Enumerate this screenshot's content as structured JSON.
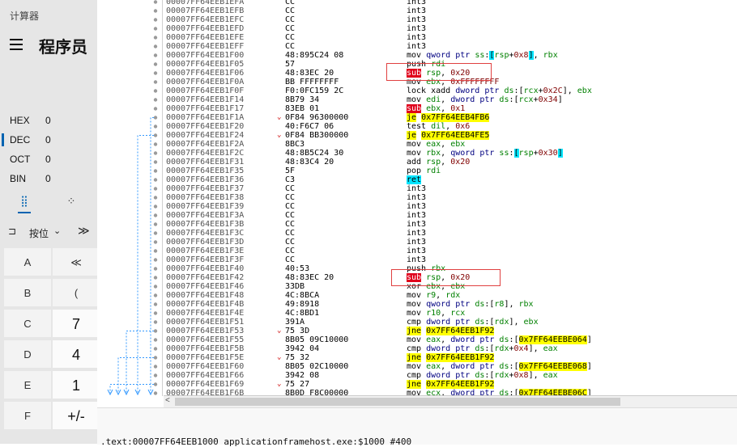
{
  "calculator": {
    "title": "计算器",
    "mode": "程序员",
    "bases": [
      {
        "label": "HEX",
        "value": "0",
        "active": false
      },
      {
        "label": "DEC",
        "value": "0",
        "active": true
      },
      {
        "label": "OCT",
        "value": "0",
        "active": false
      },
      {
        "label": "BIN",
        "value": "0",
        "active": false
      }
    ],
    "keyboard_tabs": [
      "⣿",
      "⁘"
    ],
    "bitwise": {
      "icon": "⊐",
      "label": "按位",
      "chevron": "⌄",
      "shift": "≫"
    },
    "keys": [
      {
        "label": "A",
        "kind": "op"
      },
      {
        "label": "≪",
        "kind": "op"
      },
      {
        "label": "B",
        "kind": "op"
      },
      {
        "label": "(",
        "kind": "op"
      },
      {
        "label": "C",
        "kind": "op"
      },
      {
        "label": "7",
        "kind": "num"
      },
      {
        "label": "D",
        "kind": "op"
      },
      {
        "label": "4",
        "kind": "num"
      },
      {
        "label": "E",
        "kind": "op"
      },
      {
        "label": "1",
        "kind": "num"
      },
      {
        "label": "F",
        "kind": "op"
      },
      {
        "label": "+/-",
        "kind": "num"
      }
    ]
  },
  "debugger": {
    "colors": {
      "red_hl": "#e0001b",
      "yellow_hl": "#ffff00",
      "cyan_hl": "#00e5ff",
      "jump_line": "#3399ff"
    },
    "rows": [
      {
        "addr": "00007FF64EEB1EFA",
        "bytes": "CC",
        "ins": [
          [
            "mn",
            "int3"
          ]
        ]
      },
      {
        "addr": "00007FF64EEB1EFB",
        "bytes": "CC",
        "ins": [
          [
            "mn",
            "int3"
          ]
        ]
      },
      {
        "addr": "00007FF64EEB1EFC",
        "bytes": "CC",
        "ins": [
          [
            "mn",
            "int3"
          ]
        ]
      },
      {
        "addr": "00007FF64EEB1EFD",
        "bytes": "CC",
        "ins": [
          [
            "mn",
            "int3"
          ]
        ]
      },
      {
        "addr": "00007FF64EEB1EFE",
        "bytes": "CC",
        "ins": [
          [
            "mn",
            "int3"
          ]
        ]
      },
      {
        "addr": "00007FF64EEB1EFF",
        "bytes": "CC",
        "ins": [
          [
            "mn",
            "int3"
          ]
        ]
      },
      {
        "addr": "00007FF64EEB1F00",
        "bytes": "48:895C24 08",
        "ins": [
          [
            "mn",
            "mov "
          ],
          [
            "kw",
            "qword ptr "
          ],
          [
            "reg",
            "ss"
          ],
          [
            "mn",
            ":"
          ],
          [
            "hl-cyan",
            "["
          ],
          [
            "reg",
            "rsp"
          ],
          [
            "mn",
            "+"
          ],
          [
            "num",
            "0x8"
          ],
          [
            "hl-cyan",
            "]"
          ],
          [
            "mn",
            ", "
          ],
          [
            "reg",
            "rbx"
          ]
        ]
      },
      {
        "addr": "00007FF64EEB1F05",
        "bytes": "57",
        "ins": [
          [
            "mn",
            "push "
          ],
          [
            "reg",
            "rdi"
          ]
        ]
      },
      {
        "addr": "00007FF64EEB1F06",
        "bytes": "48:83EC 20",
        "ins": [
          [
            "hl-red",
            "sub"
          ],
          [
            "mn",
            " "
          ],
          [
            "reg",
            "rsp"
          ],
          [
            "mn",
            ", "
          ],
          [
            "num",
            "0x20"
          ]
        ]
      },
      {
        "addr": "00007FF64EEB1F0A",
        "bytes": "BB FFFFFFFF",
        "ins": [
          [
            "mn",
            "mov "
          ],
          [
            "reg",
            "ebx"
          ],
          [
            "mn",
            ", "
          ],
          [
            "num",
            "0xFFFFFFFF"
          ]
        ]
      },
      {
        "addr": "00007FF64EEB1F0F",
        "bytes": "F0:0FC159 2C",
        "ins": [
          [
            "mn",
            "lock xadd "
          ],
          [
            "kw",
            "dword ptr "
          ],
          [
            "reg",
            "ds"
          ],
          [
            "mn",
            ":["
          ],
          [
            "reg",
            "rcx"
          ],
          [
            "mn",
            "+"
          ],
          [
            "num",
            "0x2C"
          ],
          [
            "mn",
            "], "
          ],
          [
            "reg",
            "ebx"
          ]
        ]
      },
      {
        "addr": "00007FF64EEB1F14",
        "bytes": "8B79 34",
        "ins": [
          [
            "mn",
            "mov "
          ],
          [
            "reg",
            "edi"
          ],
          [
            "mn",
            ", "
          ],
          [
            "kw",
            "dword ptr "
          ],
          [
            "reg",
            "ds"
          ],
          [
            "mn",
            ":["
          ],
          [
            "reg",
            "rcx"
          ],
          [
            "mn",
            "+"
          ],
          [
            "num",
            "0x34"
          ],
          [
            "mn",
            "]"
          ]
        ]
      },
      {
        "addr": "00007FF64EEB1F17",
        "bytes": "83EB 01",
        "ins": [
          [
            "hl-red",
            "sub"
          ],
          [
            "mn",
            " "
          ],
          [
            "reg",
            "ebx"
          ],
          [
            "mn",
            ", "
          ],
          [
            "num",
            "0x1"
          ]
        ]
      },
      {
        "addr": "00007FF64EEB1F1A",
        "bytes": "0F84 96300000",
        "arrow": "⌄",
        "ins": [
          [
            "hl-yel",
            "je"
          ],
          [
            "mn",
            " "
          ],
          [
            "hl-yel",
            "0x7FF64EEB4FB6"
          ]
        ]
      },
      {
        "addr": "00007FF64EEB1F20",
        "bytes": "40:F6C7 06",
        "ins": [
          [
            "mn",
            "test "
          ],
          [
            "reg",
            "dil"
          ],
          [
            "mn",
            ", "
          ],
          [
            "num",
            "0x6"
          ]
        ]
      },
      {
        "addr": "00007FF64EEB1F24",
        "bytes": "0F84 BB300000",
        "arrow": "⌄",
        "ins": [
          [
            "hl-yel",
            "je"
          ],
          [
            "mn",
            " "
          ],
          [
            "hl-yel",
            "0x7FF64EEB4FE5"
          ]
        ]
      },
      {
        "addr": "00007FF64EEB1F2A",
        "bytes": "8BC3",
        "ins": [
          [
            "mn",
            "mov "
          ],
          [
            "reg",
            "eax"
          ],
          [
            "mn",
            ", "
          ],
          [
            "reg",
            "ebx"
          ]
        ]
      },
      {
        "addr": "00007FF64EEB1F2C",
        "bytes": "48:8B5C24 30",
        "ins": [
          [
            "mn",
            "mov "
          ],
          [
            "reg",
            "rbx"
          ],
          [
            "mn",
            ", "
          ],
          [
            "kw",
            "qword ptr "
          ],
          [
            "reg",
            "ss"
          ],
          [
            "mn",
            ":"
          ],
          [
            "hl-cyan",
            "["
          ],
          [
            "reg",
            "rsp"
          ],
          [
            "mn",
            "+"
          ],
          [
            "num",
            "0x30"
          ],
          [
            "hl-cyan",
            "]"
          ]
        ]
      },
      {
        "addr": "00007FF64EEB1F31",
        "bytes": "48:83C4 20",
        "ins": [
          [
            "mn",
            "add "
          ],
          [
            "reg",
            "rsp"
          ],
          [
            "mn",
            ", "
          ],
          [
            "num",
            "0x20"
          ]
        ]
      },
      {
        "addr": "00007FF64EEB1F35",
        "bytes": "5F",
        "ins": [
          [
            "mn",
            "pop "
          ],
          [
            "reg",
            "rdi"
          ]
        ]
      },
      {
        "addr": "00007FF64EEB1F36",
        "bytes": "C3",
        "ins": [
          [
            "hl-cyan",
            "ret"
          ]
        ]
      },
      {
        "addr": "00007FF64EEB1F37",
        "bytes": "CC",
        "ins": [
          [
            "mn",
            "int3"
          ]
        ]
      },
      {
        "addr": "00007FF64EEB1F38",
        "bytes": "CC",
        "ins": [
          [
            "mn",
            "int3"
          ]
        ]
      },
      {
        "addr": "00007FF64EEB1F39",
        "bytes": "CC",
        "ins": [
          [
            "mn",
            "int3"
          ]
        ]
      },
      {
        "addr": "00007FF64EEB1F3A",
        "bytes": "CC",
        "ins": [
          [
            "mn",
            "int3"
          ]
        ]
      },
      {
        "addr": "00007FF64EEB1F3B",
        "bytes": "CC",
        "ins": [
          [
            "mn",
            "int3"
          ]
        ]
      },
      {
        "addr": "00007FF64EEB1F3C",
        "bytes": "CC",
        "ins": [
          [
            "mn",
            "int3"
          ]
        ]
      },
      {
        "addr": "00007FF64EEB1F3D",
        "bytes": "CC",
        "ins": [
          [
            "mn",
            "int3"
          ]
        ]
      },
      {
        "addr": "00007FF64EEB1F3E",
        "bytes": "CC",
        "ins": [
          [
            "mn",
            "int3"
          ]
        ]
      },
      {
        "addr": "00007FF64EEB1F3F",
        "bytes": "CC",
        "ins": [
          [
            "mn",
            "int3"
          ]
        ]
      },
      {
        "addr": "00007FF64EEB1F40",
        "bytes": "40:53",
        "ins": [
          [
            "mn",
            "push "
          ],
          [
            "reg",
            "rbx"
          ]
        ]
      },
      {
        "addr": "00007FF64EEB1F42",
        "bytes": "48:83EC 20",
        "ins": [
          [
            "hl-red",
            "sub"
          ],
          [
            "mn",
            " "
          ],
          [
            "reg",
            "rsp"
          ],
          [
            "mn",
            ", "
          ],
          [
            "num",
            "0x20"
          ]
        ]
      },
      {
        "addr": "00007FF64EEB1F46",
        "bytes": "33DB",
        "ins": [
          [
            "mn",
            "xor "
          ],
          [
            "reg",
            "ebx"
          ],
          [
            "mn",
            ", "
          ],
          [
            "reg",
            "ebx"
          ]
        ]
      },
      {
        "addr": "00007FF64EEB1F48",
        "bytes": "4C:8BCA",
        "ins": [
          [
            "mn",
            "mov "
          ],
          [
            "reg",
            "r9"
          ],
          [
            "mn",
            ", "
          ],
          [
            "reg",
            "rdx"
          ]
        ]
      },
      {
        "addr": "00007FF64EEB1F4B",
        "bytes": "49:8918",
        "ins": [
          [
            "mn",
            "mov "
          ],
          [
            "kw",
            "qword ptr "
          ],
          [
            "reg",
            "ds"
          ],
          [
            "mn",
            ":["
          ],
          [
            "reg",
            "r8"
          ],
          [
            "mn",
            "], "
          ],
          [
            "reg",
            "rbx"
          ]
        ]
      },
      {
        "addr": "00007FF64EEB1F4E",
        "bytes": "4C:8BD1",
        "ins": [
          [
            "mn",
            "mov "
          ],
          [
            "reg",
            "r10"
          ],
          [
            "mn",
            ", "
          ],
          [
            "reg",
            "rcx"
          ]
        ]
      },
      {
        "addr": "00007FF64EEB1F51",
        "bytes": "391A",
        "ins": [
          [
            "mn",
            "cmp "
          ],
          [
            "kw",
            "dword ptr "
          ],
          [
            "reg",
            "ds"
          ],
          [
            "mn",
            ":["
          ],
          [
            "reg",
            "rdx"
          ],
          [
            "mn",
            "], "
          ],
          [
            "reg",
            "ebx"
          ]
        ]
      },
      {
        "addr": "00007FF64EEB1F53",
        "bytes": "75 3D",
        "arrow": "⌄",
        "ins": [
          [
            "hl-yel",
            "jne"
          ],
          [
            "mn",
            " "
          ],
          [
            "hl-yel",
            "0x7FF64EEB1F92"
          ]
        ]
      },
      {
        "addr": "00007FF64EEB1F55",
        "bytes": "8B05 09C10000",
        "ins": [
          [
            "mn",
            "mov "
          ],
          [
            "reg",
            "eax"
          ],
          [
            "mn",
            ", "
          ],
          [
            "kw",
            "dword ptr "
          ],
          [
            "reg",
            "ds"
          ],
          [
            "mn",
            ":["
          ],
          [
            "hl-yel",
            "0x7FF64EEBE064"
          ],
          [
            "mn",
            "]"
          ]
        ]
      },
      {
        "addr": "00007FF64EEB1F5B",
        "bytes": "3942 04",
        "ins": [
          [
            "mn",
            "cmp "
          ],
          [
            "kw",
            "dword ptr "
          ],
          [
            "reg",
            "ds"
          ],
          [
            "mn",
            ":["
          ],
          [
            "reg",
            "rdx"
          ],
          [
            "mn",
            "+"
          ],
          [
            "num",
            "0x4"
          ],
          [
            "mn",
            "], "
          ],
          [
            "reg",
            "eax"
          ]
        ]
      },
      {
        "addr": "00007FF64EEB1F5E",
        "bytes": "75 32",
        "arrow": "⌄",
        "ins": [
          [
            "hl-yel",
            "jne"
          ],
          [
            "mn",
            " "
          ],
          [
            "hl-yel",
            "0x7FF64EEB1F92"
          ]
        ]
      },
      {
        "addr": "00007FF64EEB1F60",
        "bytes": "8B05 02C10000",
        "ins": [
          [
            "mn",
            "mov "
          ],
          [
            "reg",
            "eax"
          ],
          [
            "mn",
            ", "
          ],
          [
            "kw",
            "dword ptr "
          ],
          [
            "reg",
            "ds"
          ],
          [
            "mn",
            ":["
          ],
          [
            "hl-yel",
            "0x7FF64EEBE068"
          ],
          [
            "mn",
            "]"
          ]
        ]
      },
      {
        "addr": "00007FF64EEB1F66",
        "bytes": "3942 08",
        "ins": [
          [
            "mn",
            "cmp "
          ],
          [
            "kw",
            "dword ptr "
          ],
          [
            "reg",
            "ds"
          ],
          [
            "mn",
            ":["
          ],
          [
            "reg",
            "rdx"
          ],
          [
            "mn",
            "+"
          ],
          [
            "num",
            "0x8"
          ],
          [
            "mn",
            "], "
          ],
          [
            "reg",
            "eax"
          ]
        ]
      },
      {
        "addr": "00007FF64EEB1F69",
        "bytes": "75 27",
        "arrow": "⌄",
        "ins": [
          [
            "hl-yel",
            "jne"
          ],
          [
            "mn",
            " "
          ],
          [
            "hl-yel",
            "0x7FF64EEB1F92"
          ]
        ]
      },
      {
        "addr": "00007FF64EEB1F6B",
        "bytes": "8B0D F8C00000",
        "ins": [
          [
            "mn",
            "mov "
          ],
          [
            "reg",
            "ecx"
          ],
          [
            "mn",
            ", "
          ],
          [
            "kw",
            "dword ptr "
          ],
          [
            "reg",
            "ds"
          ],
          [
            "mn",
            ":["
          ],
          [
            "hl-yel",
            "0x7FF64EEBE06C"
          ],
          [
            "mn",
            "]"
          ]
        ]
      }
    ],
    "statusbar": ".text:00007FF64EEB1000 applicationframehost.exe:$1000 #400"
  }
}
